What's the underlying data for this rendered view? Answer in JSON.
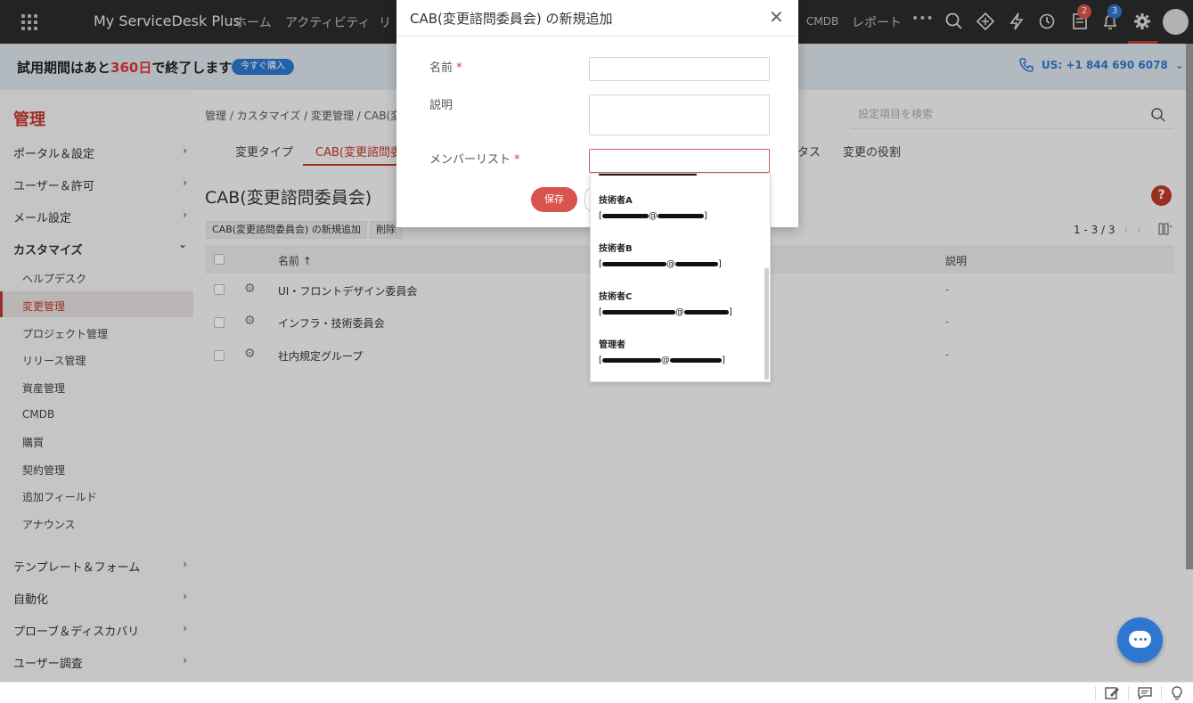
{
  "app": {
    "brand": "My ServiceDesk Plus"
  },
  "topnav": {
    "items": [
      "ホーム",
      "アクティビティ",
      "リ",
      "CMDB",
      "レポート",
      "•••"
    ],
    "badges": {
      "requests": "2",
      "notifications": "3"
    }
  },
  "trial": {
    "text_before": "試用期間はあと",
    "days": "360日",
    "text_after": "で終了します",
    "buy_label": "今すぐ購入",
    "phone": "US: +1 844 690 6078"
  },
  "sidebar": {
    "title": "管理",
    "sections": [
      {
        "label": "ポータル＆設定",
        "chevron": "›"
      },
      {
        "label": "ユーザー＆許可",
        "chevron": "›"
      },
      {
        "label": "メール設定",
        "chevron": "›"
      },
      {
        "label": "カスタマイズ",
        "chevron": "⌄"
      }
    ],
    "sub_items": [
      "ヘルプデスク",
      "変更管理",
      "プロジェクト管理",
      "リリース管理",
      "資産管理",
      "CMDB",
      "購買",
      "契約管理",
      "追加フィールド",
      "アナウンス"
    ],
    "more_sections": [
      {
        "label": "テンプレート＆フォーム",
        "chevron": "›"
      },
      {
        "label": "自動化",
        "chevron": "›"
      },
      {
        "label": "プローブ＆ディスカバリ",
        "chevron": "›"
      },
      {
        "label": "ユーザー調査",
        "chevron": "›"
      }
    ]
  },
  "main": {
    "breadcrumb": "管理 / カスタマイズ / 変更管理 / CAB(変更",
    "search_placeholder": "設定項目を検索",
    "tabs": [
      "変更タイプ",
      "CAB(変更諮問委",
      "タス",
      "変更の役割"
    ],
    "page_title": "CAB(変更諮問委員会)",
    "add_button": "CAB(変更諮問委員会) の新規追加",
    "delete_button": "削除",
    "pager": "1 - 3 / 3",
    "columns": {
      "name": "名前 ↑",
      "description": "説明"
    },
    "rows": [
      {
        "name": "UI・フロントデザイン委員会",
        "description": "-"
      },
      {
        "name": "インフラ・技術委員会",
        "description": "-"
      },
      {
        "name": "社内規定グループ",
        "description": "-"
      }
    ]
  },
  "modal": {
    "title": "CAB(変更諮問委員会) の新規追加",
    "close": "✕",
    "fields": {
      "name_label": "名前",
      "description_label": "説明",
      "members_label": "メンバーリスト",
      "required": "*"
    },
    "save_label": "保存",
    "member_options": [
      {
        "name": "技術者A",
        "email_at": "@"
      },
      {
        "name": "技術者B",
        "email_at": "@"
      },
      {
        "name": "技術者C",
        "email_at": "@"
      },
      {
        "name": "管理者",
        "email_at": "@"
      }
    ]
  },
  "colors": {
    "accent": "#c0392b",
    "link": "#2e77d0",
    "topbar": "#2b2b2b"
  }
}
